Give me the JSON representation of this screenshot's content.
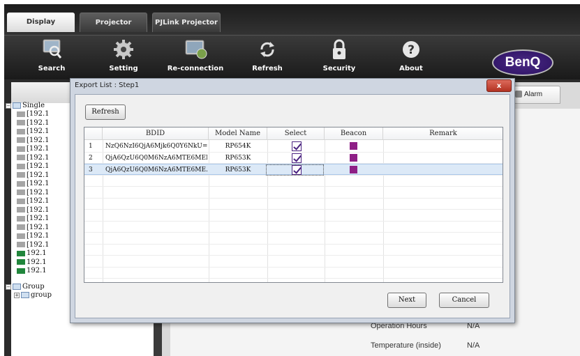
{
  "top_tabs": [
    {
      "label": "Display",
      "active": true
    },
    {
      "label": "Projector",
      "active": false
    },
    {
      "label": "PJLink Projector",
      "active": false
    }
  ],
  "toolbar": {
    "items": [
      {
        "label": "Search",
        "icon": "search-icon"
      },
      {
        "label": "Setting",
        "icon": "gear-icon"
      },
      {
        "label": "Re-connection",
        "icon": "reconnect-icon"
      },
      {
        "label": "Refresh",
        "icon": "refresh-icon"
      },
      {
        "label": "Security",
        "icon": "lock-icon"
      },
      {
        "label": "About",
        "icon": "help-icon"
      }
    ],
    "brand": "BenQ"
  },
  "left_panel": {
    "tree": {
      "single_label": "Single",
      "items": [
        "[192.1",
        "[192.1",
        "[192.1",
        "[192.1",
        "[192.1",
        "[192.1",
        "[192.1",
        "[192.1",
        "[192.1",
        "[192.1",
        "[192.1",
        "[192.1",
        "[192.1",
        "[192.1",
        "[192.1",
        "[192.1",
        "192.1",
        "192.1",
        "192.1"
      ],
      "item_status": [
        "offline",
        "offline",
        "offline",
        "offline",
        "offline",
        "offline",
        "offline",
        "offline",
        "offline",
        "offline",
        "offline",
        "offline",
        "offline",
        "offline",
        "offline",
        "offline",
        "online",
        "online",
        "online"
      ],
      "group_label": "Group",
      "group_child": "group"
    }
  },
  "right_panel": {
    "alarm_tab": "Alarm",
    "rows": [
      {
        "label": "Operation Hours",
        "value": "N/A"
      },
      {
        "label": "Temperature (inside)",
        "value": "N/A"
      }
    ]
  },
  "dialog": {
    "title": "Export List : Step1",
    "close_label": "x",
    "refresh_label": "Refresh",
    "columns": [
      "BDID",
      "Model Name",
      "Select",
      "Beacon",
      "Remark"
    ],
    "rows": [
      {
        "index": "1",
        "bdid": "NzQ6NzI6QjA6Mjk6Q0Y6NkU=",
        "model": "RP654K",
        "selected": true,
        "beacon_color": "#8e1f86",
        "remark": ""
      },
      {
        "index": "2",
        "bdid": "QjA6QzU6Q0M6NzA6MTE6MEI=",
        "model": "RP653K",
        "selected": true,
        "beacon_color": "#8e1f86",
        "remark": ""
      },
      {
        "index": "3",
        "bdid": "QjA6QzU6Q0M6NzA6MTE6ME...",
        "model": "RP653K",
        "selected": true,
        "beacon_color": "#8e1f86",
        "remark": "",
        "highlighted": true
      }
    ],
    "next_label": "Next",
    "cancel_label": "Cancel"
  },
  "colors": {
    "accent": "#4a2380",
    "beacon": "#8e1f86",
    "online": "#21863c",
    "offline": "#a5a5a5"
  }
}
